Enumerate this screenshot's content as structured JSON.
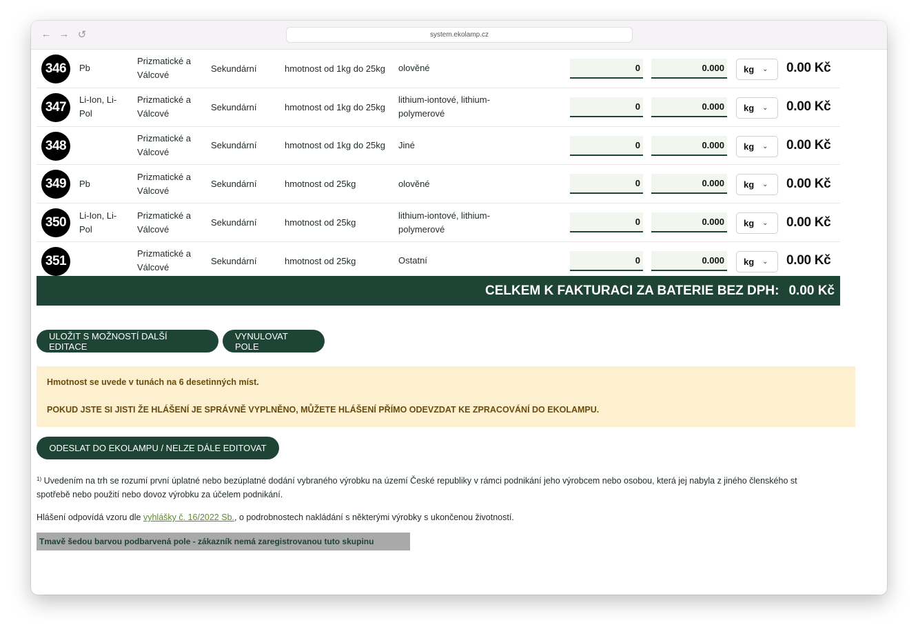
{
  "browser": {
    "url": "system.ekolamp.cz",
    "back_icon": "←",
    "forward_icon": "→",
    "reload_icon": "↺"
  },
  "rows": [
    {
      "num": "346",
      "chem": "Pb",
      "shape": "Prizmatické a Válcové",
      "type": "Sekundární",
      "weight": "hmotnost od 1kg do 25kg",
      "desc": "olověné",
      "qty": "0",
      "mass": "0.000",
      "unit": "kg",
      "price": "0.00 Kč"
    },
    {
      "num": "347",
      "chem": "Li-Ion, Li-Pol",
      "shape": "Prizmatické a Válcové",
      "type": "Sekundární",
      "weight": "hmotnost od 1kg do 25kg",
      "desc": "lithium-iontové, lithium-polymerové",
      "qty": "0",
      "mass": "0.000",
      "unit": "kg",
      "price": "0.00 Kč"
    },
    {
      "num": "348",
      "chem": "",
      "shape": "Prizmatické a Válcové",
      "type": "Sekundární",
      "weight": "hmotnost od 1kg do 25kg",
      "desc": "Jiné",
      "qty": "0",
      "mass": "0.000",
      "unit": "kg",
      "price": "0.00 Kč"
    },
    {
      "num": "349",
      "chem": "Pb",
      "shape": "Prizmatické a Válcové",
      "type": "Sekundární",
      "weight": "hmotnost od 25kg",
      "desc": "olověné",
      "qty": "0",
      "mass": "0.000",
      "unit": "kg",
      "price": "0.00 Kč"
    },
    {
      "num": "350",
      "chem": "Li-Ion, Li-Pol",
      "shape": "Prizmatické a Válcové",
      "type": "Sekundární",
      "weight": "hmotnost od 25kg",
      "desc": "lithium-iontové, lithium-polymerové",
      "qty": "0",
      "mass": "0.000",
      "unit": "kg",
      "price": "0.00 Kč"
    },
    {
      "num": "351",
      "chem": "",
      "shape": "Prizmatické a Válcové",
      "type": "Sekundární",
      "weight": "hmotnost od 25kg",
      "desc": "Ostatní",
      "qty": "0",
      "mass": "0.000",
      "unit": "kg",
      "price": "0.00 Kč"
    }
  ],
  "total": {
    "label": "CELKEM K FAKTURACI ZA BATERIE BEZ DPH:",
    "value": "0.00 Kč"
  },
  "buttons": {
    "save": "ULOŽIT S MOŽNOSTÍ DALŠÍ EDITACE",
    "reset": "VYNULOVAT POLE",
    "send": "ODESLAT DO EKOLAMPU / NELZE DÁLE EDITOVAT"
  },
  "notice": {
    "line1": "Hmotnost se uvede v tunách na 6 desetinných míst.",
    "line2": "POKUD JSTE SI JISTI ŽE HLÁŠENÍ JE SPRÁVNĚ VYPLNĚNO, MŮŽETE HLÁŠENÍ PŘÍMO ODEVZDAT KE ZPRACOVÁNÍ DO EKOLAMPU."
  },
  "footnote": {
    "mark": "1)",
    "line1": "Uvedením na trh se rozumí první úplatné nebo bezúplatné dodání vybraného výrobku na území České republiky v rámci podnikání jeho výrobcem nebo osobou, která jej nabyla z jiného členského st",
    "line2": "spotřebě nebo použití nebo dovoz výrobku za účelem podnikání."
  },
  "decree": {
    "prefix": "Hlášení odpovídá vzoru dle ",
    "link": "vyhlášky č. 16/2022 Sb.",
    "suffix": ", o podrobnostech nakládání s některými výrobky s ukončenou životností."
  },
  "grey_note": "Tmavě šedou barvou podbarvená pole - zákazník nemá zaregistrovanou tuto skupinu",
  "colors": {
    "accent": "#1e4436",
    "notice_bg": "#fcf0cf",
    "notice_text": "#6b4a0c",
    "link": "#5d8d2a",
    "grey": "#a9a9a9"
  }
}
